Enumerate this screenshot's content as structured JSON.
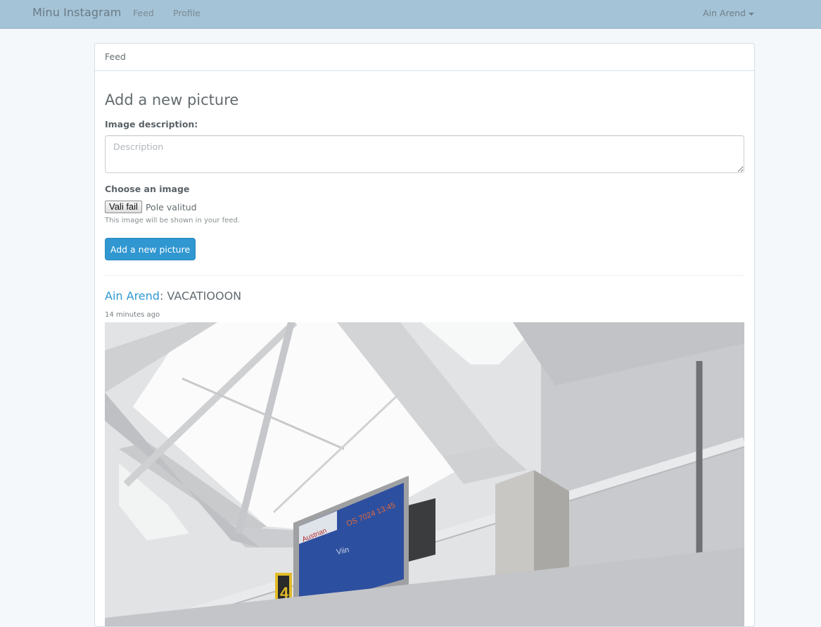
{
  "navbar": {
    "brand": "Minu Instagram",
    "links": [
      {
        "label": "Feed"
      },
      {
        "label": "Profile"
      }
    ],
    "user": {
      "name": "Ain Arend",
      "icon": "caret-down-icon"
    }
  },
  "panel": {
    "heading": "Feed"
  },
  "form": {
    "title": "Add a new picture",
    "description_label": "Image description:",
    "description_placeholder": "Description",
    "description_value": "",
    "image_label": "Choose an image",
    "file_button": "Vali fail",
    "file_status": "Pole valitud",
    "help_text": "This image will be shown in your feed.",
    "submit_label": "Add a new picture"
  },
  "post": {
    "author": "Ain Arend",
    "separator": ": ",
    "caption": "VACATIOOON",
    "time": "14 minutes ago"
  },
  "colors": {
    "navbar_bg": "#a4c3d6",
    "page_bg": "#f5f8fa",
    "accent": "#3097d1"
  }
}
